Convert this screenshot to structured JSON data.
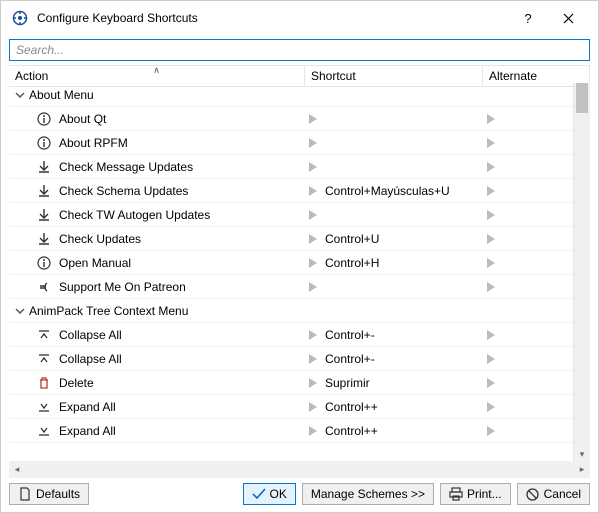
{
  "window": {
    "title": "Configure Keyboard Shortcuts"
  },
  "search": {
    "placeholder": "Search..."
  },
  "columns": {
    "action": "Action",
    "shortcut": "Shortcut",
    "alternate": "Alternate"
  },
  "groups": {
    "about": "About Menu",
    "animpack": "AnimPack Tree Context Menu"
  },
  "rows": {
    "about_qt": {
      "label": "About Qt",
      "shortcut": "",
      "alternate": ""
    },
    "about_rpfm": {
      "label": "About RPFM",
      "shortcut": "",
      "alternate": ""
    },
    "check_msg": {
      "label": "Check Message Updates",
      "shortcut": "",
      "alternate": ""
    },
    "check_schema": {
      "label": "Check Schema Updates",
      "shortcut": "Control+Mayúsculas+U",
      "alternate": ""
    },
    "check_tw": {
      "label": "Check TW Autogen Updates",
      "shortcut": "",
      "alternate": ""
    },
    "check_updates": {
      "label": "Check Updates",
      "shortcut": "Control+U",
      "alternate": ""
    },
    "open_manual": {
      "label": "Open Manual",
      "shortcut": "Control+H",
      "alternate": ""
    },
    "support": {
      "label": "Support Me On Patreon",
      "shortcut": "",
      "alternate": ""
    },
    "collapse1": {
      "label": "Collapse All",
      "shortcut": "Control+-",
      "alternate": ""
    },
    "collapse2": {
      "label": "Collapse All",
      "shortcut": "Control+-",
      "alternate": ""
    },
    "delete": {
      "label": "Delete",
      "shortcut": "Suprimir",
      "alternate": ""
    },
    "expand1": {
      "label": "Expand All",
      "shortcut": "Control++",
      "alternate": ""
    },
    "expand2": {
      "label": "Expand All",
      "shortcut": "Control++",
      "alternate": ""
    }
  },
  "buttons": {
    "defaults": "Defaults",
    "ok": "OK",
    "manage": "Manage Schemes >>",
    "print": "Print...",
    "cancel": "Cancel"
  }
}
